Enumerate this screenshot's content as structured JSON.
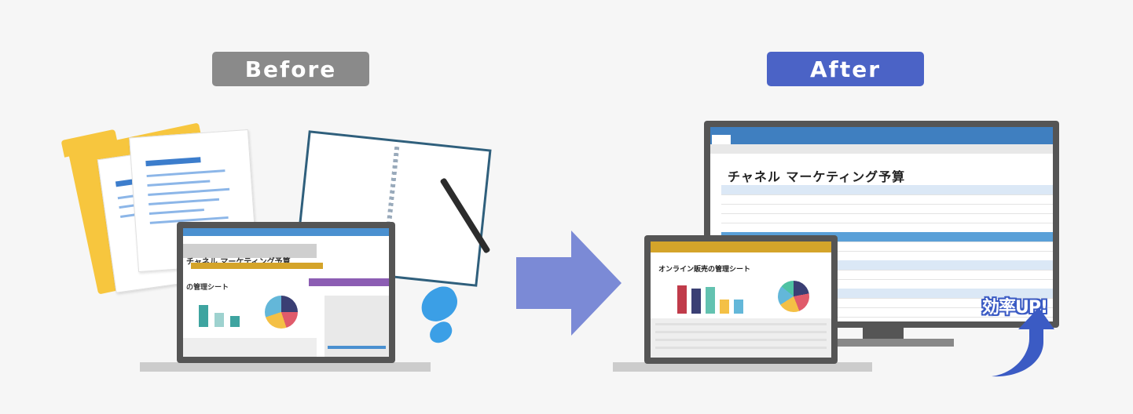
{
  "labels": {
    "before": "Before",
    "after": "After",
    "boost": "効率UP!"
  },
  "before_screen": {
    "title": "チャネル マーケティング予算",
    "sheet": "の管理シート"
  },
  "after_monitor": {
    "title": "チャネル マーケティング予算"
  },
  "after_laptop": {
    "title": "オンライン販売の管理シート"
  },
  "colors": {
    "before_tag": "#8a8a8a",
    "after_tag": "#4b63c6",
    "arrow": "#7b8ad6",
    "boost": "#3b5bc4"
  }
}
